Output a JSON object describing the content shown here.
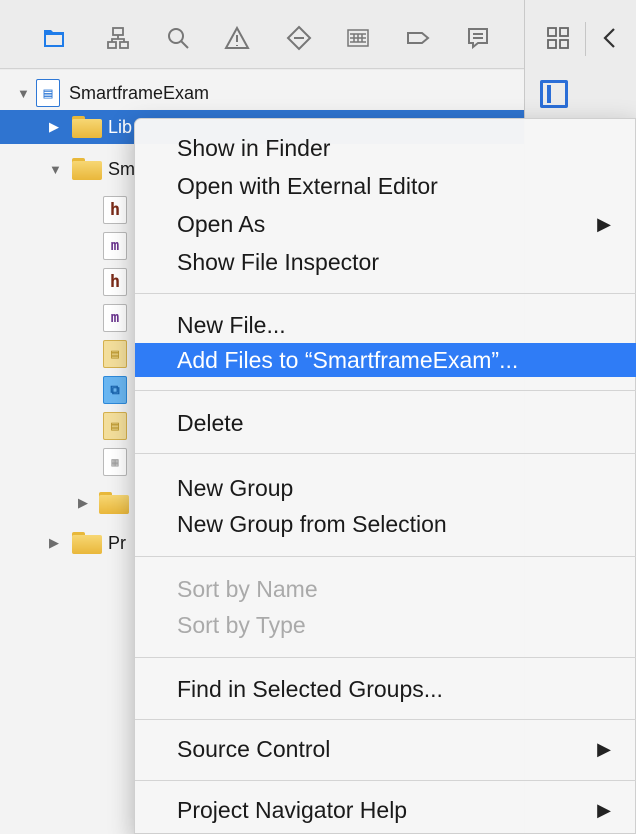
{
  "toolbar": {
    "icons": [
      "folder-icon",
      "hierarchy-icon",
      "search-icon",
      "warning-icon",
      "breakpoint-icon",
      "list-icon",
      "tag-icon",
      "message-icon",
      "grid-icon",
      "back-icon"
    ],
    "accent": "#1f7ce9"
  },
  "navigator": {
    "project_name": "SmartframeExam",
    "rows": [
      {
        "label": "Lib",
        "type": "folder",
        "level": 1
      },
      {
        "label": "Sm",
        "type": "folder",
        "level": 1
      },
      {
        "label": "h",
        "type": "file-h"
      },
      {
        "label": "m",
        "type": "file-m"
      },
      {
        "label": "h",
        "type": "file-h"
      },
      {
        "label": "m",
        "type": "file-m"
      },
      {
        "label": "",
        "type": "storyboard"
      },
      {
        "label": "",
        "type": "assets"
      },
      {
        "label": "",
        "type": "storyboard"
      },
      {
        "label": "",
        "type": "plist"
      },
      {
        "label": "",
        "type": "folder"
      },
      {
        "label": "Pr",
        "type": "folder"
      }
    ]
  },
  "menu": {
    "show_in_finder": "Show in Finder",
    "open_external": "Open with External Editor",
    "open_as": "Open As",
    "show_file_inspector": "Show File Inspector",
    "new_file": "New File...",
    "add_files": "Add Files to “SmartframeExam”...",
    "delete": "Delete",
    "new_group": "New Group",
    "new_group_selection": "New Group from Selection",
    "sort_by_name": "Sort by Name",
    "sort_by_type": "Sort by Type",
    "find_in_groups": "Find in Selected Groups...",
    "source_control": "Source Control",
    "navigator_help": "Project Navigator Help"
  },
  "colors": {
    "selection": "#2f74d0",
    "menu_highlight": "#2f7cf6"
  }
}
